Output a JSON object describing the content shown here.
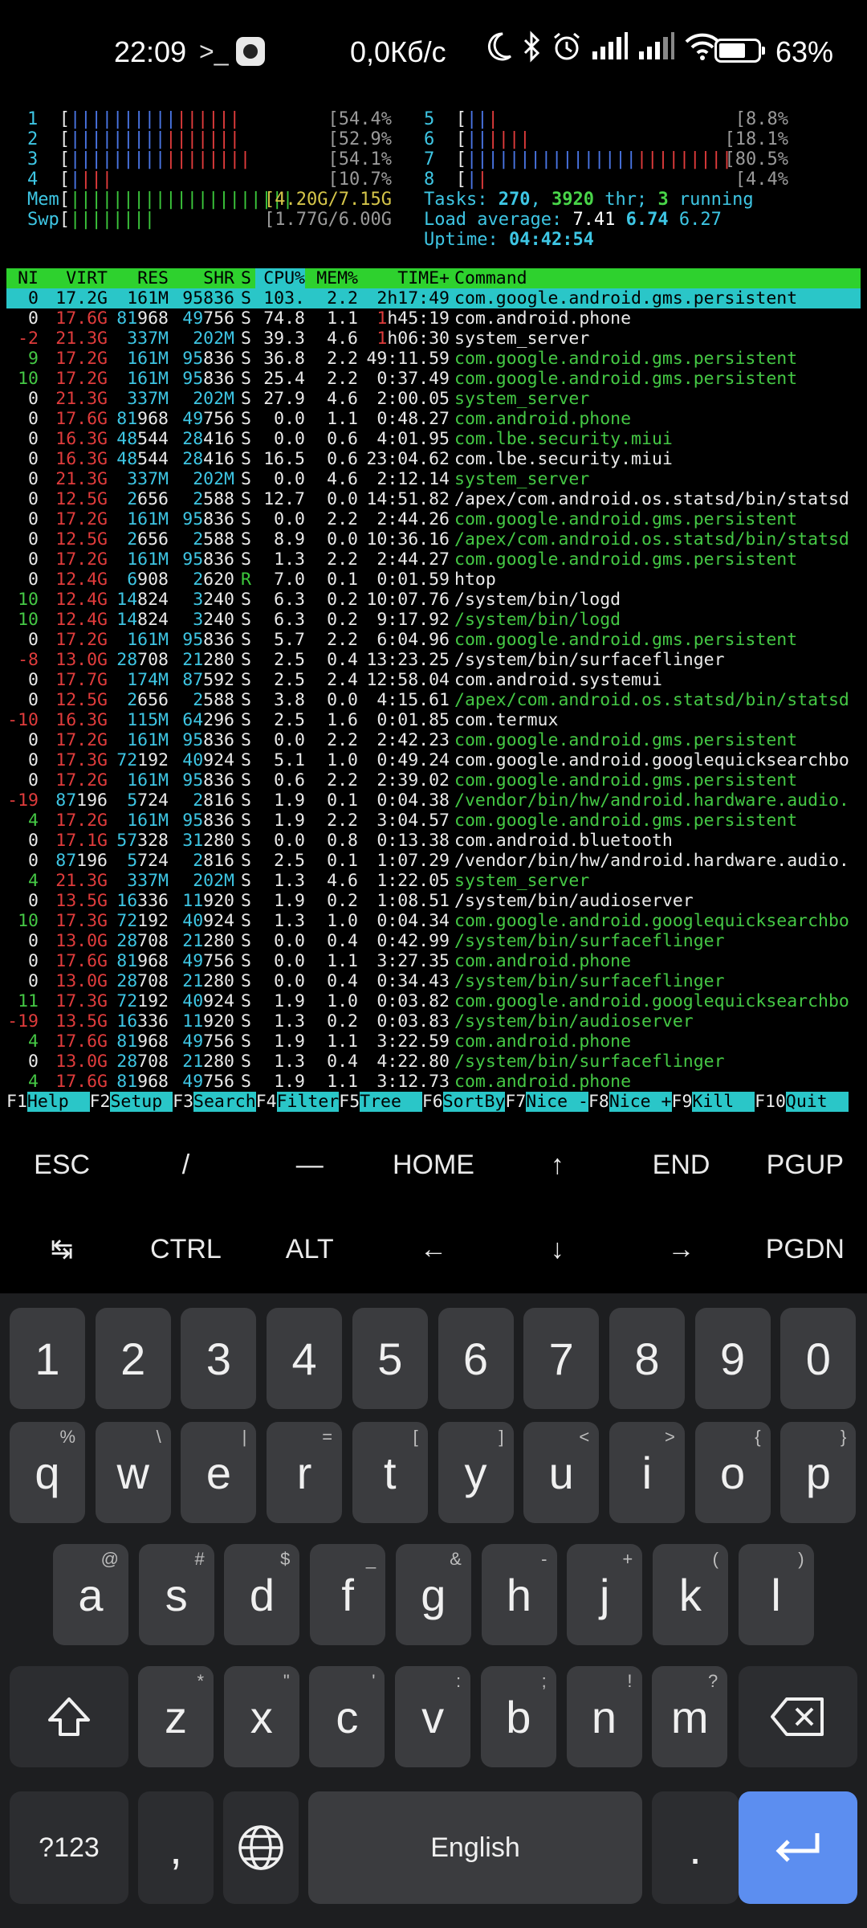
{
  "status_bar": {
    "time": "22:09",
    "prompt_icon": ">_",
    "speed": "0,0Кб/с",
    "battery_pct": "63%"
  },
  "meters": {
    "cpus_left": [
      {
        "num": "1",
        "blue": "||||||||||",
        "red": "||||||",
        "pct": "54.4%]"
      },
      {
        "num": "2",
        "blue": "|||||||||",
        "red": "|||||||",
        "pct": "52.9%]"
      },
      {
        "num": "3",
        "blue": "|||||||||",
        "red": "||||||||",
        "pct": "54.1%]"
      },
      {
        "num": "4",
        "blue": "|",
        "red": "|||",
        "pct": "10.7%]"
      }
    ],
    "cpus_right": [
      {
        "num": "5",
        "blue": "||",
        "red": "|",
        "pct": "8.8%]"
      },
      {
        "num": "6",
        "blue": "||",
        "red": "||||",
        "pct": "18.1%]"
      },
      {
        "num": "7",
        "blue": "||||||||||||||||",
        "red": "|||||||||",
        "pct": "80.5%]"
      },
      {
        "num": "8",
        "blue": "|",
        "red": "|",
        "pct": "4.4%]"
      }
    ],
    "mem": {
      "label": "Mem",
      "bar": "|||||||||||||||||||||",
      "value": "4.20G/7.15G]"
    },
    "swp": {
      "label": "Swp",
      "bar": "||||||||",
      "value": "1.77G/6.00G]"
    },
    "tasks": {
      "label": "Tasks:",
      "count": "270",
      "thr": "3920",
      "thr_label": "thr;",
      "running": "3",
      "running_label": "running"
    },
    "load": {
      "label": "Load average:",
      "v1": "7.41",
      "v2": "6.74",
      "v3": "6.27"
    },
    "uptime": {
      "label": "Uptime:",
      "value": "04:42:54"
    }
  },
  "table": {
    "headers": [
      "NI",
      "VIRT",
      "RES",
      "SHR",
      "S",
      "CPU%",
      "MEM%",
      "TIME+",
      "Command"
    ],
    "rows": [
      {
        "ni": "0",
        "virt": "17.2G",
        "res": "161M",
        "shr": "95836",
        "s": "S",
        "cpu": "103.",
        "mem": "2.2",
        "time": "2h17:49",
        "cmd": "com.google.android.gms.persistent",
        "color": "white",
        "selected": true
      },
      {
        "ni": "0",
        "virt": "17.6G",
        "res": "81968",
        "shr": "49756",
        "s": "S",
        "cpu": "74.8",
        "mem": "1.1",
        "time": "1h45:19",
        "cmd": "com.android.phone",
        "color": "white"
      },
      {
        "ni": "-2",
        "virt": "21.3G",
        "res": "337M",
        "shr": "202M",
        "s": "S",
        "cpu": "39.3",
        "mem": "4.6",
        "time": "1h06:30",
        "cmd": "system_server",
        "color": "white"
      },
      {
        "ni": "9",
        "virt": "17.2G",
        "res": "161M",
        "shr": "95836",
        "s": "S",
        "cpu": "36.8",
        "mem": "2.2",
        "time": "49:11.59",
        "cmd": "com.google.android.gms.persistent",
        "color": "green"
      },
      {
        "ni": "10",
        "virt": "17.2G",
        "res": "161M",
        "shr": "95836",
        "s": "S",
        "cpu": "25.4",
        "mem": "2.2",
        "time": "0:37.49",
        "cmd": "com.google.android.gms.persistent",
        "color": "green"
      },
      {
        "ni": "0",
        "virt": "21.3G",
        "res": "337M",
        "shr": "202M",
        "s": "S",
        "cpu": "27.9",
        "mem": "4.6",
        "time": "2:00.05",
        "cmd": "system_server",
        "color": "green"
      },
      {
        "ni": "0",
        "virt": "17.6G",
        "res": "81968",
        "shr": "49756",
        "s": "S",
        "cpu": "0.0",
        "mem": "1.1",
        "time": "0:48.27",
        "cmd": "com.android.phone",
        "color": "green"
      },
      {
        "ni": "0",
        "virt": "16.3G",
        "res": "48544",
        "shr": "28416",
        "s": "S",
        "cpu": "0.0",
        "mem": "0.6",
        "time": "4:01.95",
        "cmd": "com.lbe.security.miui",
        "color": "green"
      },
      {
        "ni": "0",
        "virt": "16.3G",
        "res": "48544",
        "shr": "28416",
        "s": "S",
        "cpu": "16.5",
        "mem": "0.6",
        "time": "23:04.62",
        "cmd": "com.lbe.security.miui",
        "color": "white"
      },
      {
        "ni": "0",
        "virt": "21.3G",
        "res": "337M",
        "shr": "202M",
        "s": "S",
        "cpu": "0.0",
        "mem": "4.6",
        "time": "2:12.14",
        "cmd": "system_server",
        "color": "green"
      },
      {
        "ni": "0",
        "virt": "12.5G",
        "res": "2656",
        "shr": "2588",
        "s": "S",
        "cpu": "12.7",
        "mem": "0.0",
        "time": "14:51.82",
        "cmd": "/apex/com.android.os.statsd/bin/statsd",
        "color": "white"
      },
      {
        "ni": "0",
        "virt": "17.2G",
        "res": "161M",
        "shr": "95836",
        "s": "S",
        "cpu": "0.0",
        "mem": "2.2",
        "time": "2:44.26",
        "cmd": "com.google.android.gms.persistent",
        "color": "green"
      },
      {
        "ni": "0",
        "virt": "12.5G",
        "res": "2656",
        "shr": "2588",
        "s": "S",
        "cpu": "8.9",
        "mem": "0.0",
        "time": "10:36.16",
        "cmd": "/apex/com.android.os.statsd/bin/statsd",
        "color": "green"
      },
      {
        "ni": "0",
        "virt": "17.2G",
        "res": "161M",
        "shr": "95836",
        "s": "S",
        "cpu": "1.3",
        "mem": "2.2",
        "time": "2:44.27",
        "cmd": "com.google.android.gms.persistent",
        "color": "green"
      },
      {
        "ni": "0",
        "virt": "12.4G",
        "res": "6908",
        "shr": "2620",
        "s": "R",
        "cpu": "7.0",
        "mem": "0.1",
        "time": "0:01.59",
        "cmd": "htop",
        "color": "white"
      },
      {
        "ni": "10",
        "virt": "12.4G",
        "res": "14824",
        "shr": "3240",
        "s": "S",
        "cpu": "6.3",
        "mem": "0.2",
        "time": "10:07.76",
        "cmd": "/system/bin/logd",
        "color": "white"
      },
      {
        "ni": "10",
        "virt": "12.4G",
        "res": "14824",
        "shr": "3240",
        "s": "S",
        "cpu": "6.3",
        "mem": "0.2",
        "time": "9:17.92",
        "cmd": "/system/bin/logd",
        "color": "green"
      },
      {
        "ni": "0",
        "virt": "17.2G",
        "res": "161M",
        "shr": "95836",
        "s": "S",
        "cpu": "5.7",
        "mem": "2.2",
        "time": "6:04.96",
        "cmd": "com.google.android.gms.persistent",
        "color": "green"
      },
      {
        "ni": "-8",
        "virt": "13.0G",
        "res": "28708",
        "shr": "21280",
        "s": "S",
        "cpu": "2.5",
        "mem": "0.4",
        "time": "13:23.25",
        "cmd": "/system/bin/surfaceflinger",
        "color": "white"
      },
      {
        "ni": "0",
        "virt": "17.7G",
        "res": "174M",
        "shr": "87592",
        "s": "S",
        "cpu": "2.5",
        "mem": "2.4",
        "time": "12:58.04",
        "cmd": "com.android.systemui",
        "color": "white"
      },
      {
        "ni": "0",
        "virt": "12.5G",
        "res": "2656",
        "shr": "2588",
        "s": "S",
        "cpu": "3.8",
        "mem": "0.0",
        "time": "4:15.61",
        "cmd": "/apex/com.android.os.statsd/bin/statsd",
        "color": "green"
      },
      {
        "ni": "-10",
        "virt": "16.3G",
        "res": "115M",
        "shr": "64296",
        "s": "S",
        "cpu": "2.5",
        "mem": "1.6",
        "time": "0:01.85",
        "cmd": "com.termux",
        "color": "white"
      },
      {
        "ni": "0",
        "virt": "17.2G",
        "res": "161M",
        "shr": "95836",
        "s": "S",
        "cpu": "0.0",
        "mem": "2.2",
        "time": "2:42.23",
        "cmd": "com.google.android.gms.persistent",
        "color": "green"
      },
      {
        "ni": "0",
        "virt": "17.3G",
        "res": "72192",
        "shr": "40924",
        "s": "S",
        "cpu": "5.1",
        "mem": "1.0",
        "time": "0:49.24",
        "cmd": "com.google.android.googlequicksearchbo",
        "color": "white"
      },
      {
        "ni": "0",
        "virt": "17.2G",
        "res": "161M",
        "shr": "95836",
        "s": "S",
        "cpu": "0.6",
        "mem": "2.2",
        "time": "2:39.02",
        "cmd": "com.google.android.gms.persistent",
        "color": "green"
      },
      {
        "ni": "-19",
        "virt": "87196",
        "res": "5724",
        "shr": "2816",
        "s": "S",
        "cpu": "1.9",
        "mem": "0.1",
        "time": "0:04.38",
        "cmd": "/vendor/bin/hw/android.hardware.audio.",
        "color": "green"
      },
      {
        "ni": "4",
        "virt": "17.2G",
        "res": "161M",
        "shr": "95836",
        "s": "S",
        "cpu": "1.9",
        "mem": "2.2",
        "time": "3:04.57",
        "cmd": "com.google.android.gms.persistent",
        "color": "green"
      },
      {
        "ni": "0",
        "virt": "17.1G",
        "res": "57328",
        "shr": "31280",
        "s": "S",
        "cpu": "0.0",
        "mem": "0.8",
        "time": "0:13.38",
        "cmd": "com.android.bluetooth",
        "color": "white"
      },
      {
        "ni": "0",
        "virt": "87196",
        "res": "5724",
        "shr": "2816",
        "s": "S",
        "cpu": "2.5",
        "mem": "0.1",
        "time": "1:07.29",
        "cmd": "/vendor/bin/hw/android.hardware.audio.",
        "color": "white"
      },
      {
        "ni": "4",
        "virt": "21.3G",
        "res": "337M",
        "shr": "202M",
        "s": "S",
        "cpu": "1.3",
        "mem": "4.6",
        "time": "1:22.05",
        "cmd": "system_server",
        "color": "green"
      },
      {
        "ni": "0",
        "virt": "13.5G",
        "res": "16336",
        "shr": "11920",
        "s": "S",
        "cpu": "1.9",
        "mem": "0.2",
        "time": "1:08.51",
        "cmd": "/system/bin/audioserver",
        "color": "white"
      },
      {
        "ni": "10",
        "virt": "17.3G",
        "res": "72192",
        "shr": "40924",
        "s": "S",
        "cpu": "1.3",
        "mem": "1.0",
        "time": "0:04.34",
        "cmd": "com.google.android.googlequicksearchbo",
        "color": "green"
      },
      {
        "ni": "0",
        "virt": "13.0G",
        "res": "28708",
        "shr": "21280",
        "s": "S",
        "cpu": "0.0",
        "mem": "0.4",
        "time": "0:42.99",
        "cmd": "/system/bin/surfaceflinger",
        "color": "green"
      },
      {
        "ni": "0",
        "virt": "17.6G",
        "res": "81968",
        "shr": "49756",
        "s": "S",
        "cpu": "0.0",
        "mem": "1.1",
        "time": "3:27.35",
        "cmd": "com.android.phone",
        "color": "green"
      },
      {
        "ni": "0",
        "virt": "13.0G",
        "res": "28708",
        "shr": "21280",
        "s": "S",
        "cpu": "0.0",
        "mem": "0.4",
        "time": "0:34.43",
        "cmd": "/system/bin/surfaceflinger",
        "color": "green"
      },
      {
        "ni": "11",
        "virt": "17.3G",
        "res": "72192",
        "shr": "40924",
        "s": "S",
        "cpu": "1.9",
        "mem": "1.0",
        "time": "0:03.82",
        "cmd": "com.google.android.googlequicksearchbo",
        "color": "green"
      },
      {
        "ni": "-19",
        "virt": "13.5G",
        "res": "16336",
        "shr": "11920",
        "s": "S",
        "cpu": "1.3",
        "mem": "0.2",
        "time": "0:03.83",
        "cmd": "/system/bin/audioserver",
        "color": "green"
      },
      {
        "ni": "4",
        "virt": "17.6G",
        "res": "81968",
        "shr": "49756",
        "s": "S",
        "cpu": "1.9",
        "mem": "1.1",
        "time": "3:22.59",
        "cmd": "com.android.phone",
        "color": "green"
      },
      {
        "ni": "0",
        "virt": "13.0G",
        "res": "28708",
        "shr": "21280",
        "s": "S",
        "cpu": "1.3",
        "mem": "0.4",
        "time": "4:22.80",
        "cmd": "/system/bin/surfaceflinger",
        "color": "green"
      },
      {
        "ni": "4",
        "virt": "17.6G",
        "res": "81968",
        "shr": "49756",
        "s": "S",
        "cpu": "1.9",
        "mem": "1.1",
        "time": "3:12.73",
        "cmd": "com.android.phone",
        "color": "green"
      }
    ]
  },
  "fkeys": [
    {
      "num": "F1",
      "label": "Help  "
    },
    {
      "num": "F2",
      "label": "Setup "
    },
    {
      "num": "F3",
      "label": "Search"
    },
    {
      "num": "F4",
      "label": "Filter"
    },
    {
      "num": "F5",
      "label": "Tree  "
    },
    {
      "num": "F6",
      "label": "SortBy"
    },
    {
      "num": "F7",
      "label": "Nice -"
    },
    {
      "num": "F8",
      "label": "Nice +"
    },
    {
      "num": "F9",
      "label": "Kill  "
    },
    {
      "num": "F10",
      "label": "Quit  "
    }
  ],
  "extra_keys": {
    "row1": [
      "ESC",
      "/",
      "—",
      "HOME",
      "↑",
      "END",
      "PGUP"
    ],
    "row2": [
      "↹",
      "CTRL",
      "ALT",
      "←",
      "↓",
      "→",
      "PGDN"
    ]
  },
  "keyboard": {
    "numbers": [
      "1",
      "2",
      "3",
      "4",
      "5",
      "6",
      "7",
      "8",
      "9",
      "0"
    ],
    "row1": [
      {
        "k": "q",
        "s": "%"
      },
      {
        "k": "w",
        "s": "\\"
      },
      {
        "k": "e",
        "s": "|"
      },
      {
        "k": "r",
        "s": "="
      },
      {
        "k": "t",
        "s": "["
      },
      {
        "k": "y",
        "s": "]"
      },
      {
        "k": "u",
        "s": "<"
      },
      {
        "k": "i",
        "s": ">"
      },
      {
        "k": "o",
        "s": "{"
      },
      {
        "k": "p",
        "s": "}"
      }
    ],
    "row2": [
      {
        "k": "a",
        "s": "@"
      },
      {
        "k": "s",
        "s": "#"
      },
      {
        "k": "d",
        "s": "$"
      },
      {
        "k": "f",
        "s": "_"
      },
      {
        "k": "g",
        "s": "&"
      },
      {
        "k": "h",
        "s": "-"
      },
      {
        "k": "j",
        "s": "+"
      },
      {
        "k": "k",
        "s": "("
      },
      {
        "k": "l",
        "s": ")"
      }
    ],
    "row3": [
      {
        "k": "z",
        "s": "*"
      },
      {
        "k": "x",
        "s": "\""
      },
      {
        "k": "c",
        "s": "'"
      },
      {
        "k": "v",
        "s": ":"
      },
      {
        "k": "b",
        "s": ";"
      },
      {
        "k": "n",
        "s": "!"
      },
      {
        "k": "m",
        "s": "?"
      }
    ],
    "symbols_label": "?123",
    "comma": ",",
    "space_label": "English",
    "period": "."
  }
}
